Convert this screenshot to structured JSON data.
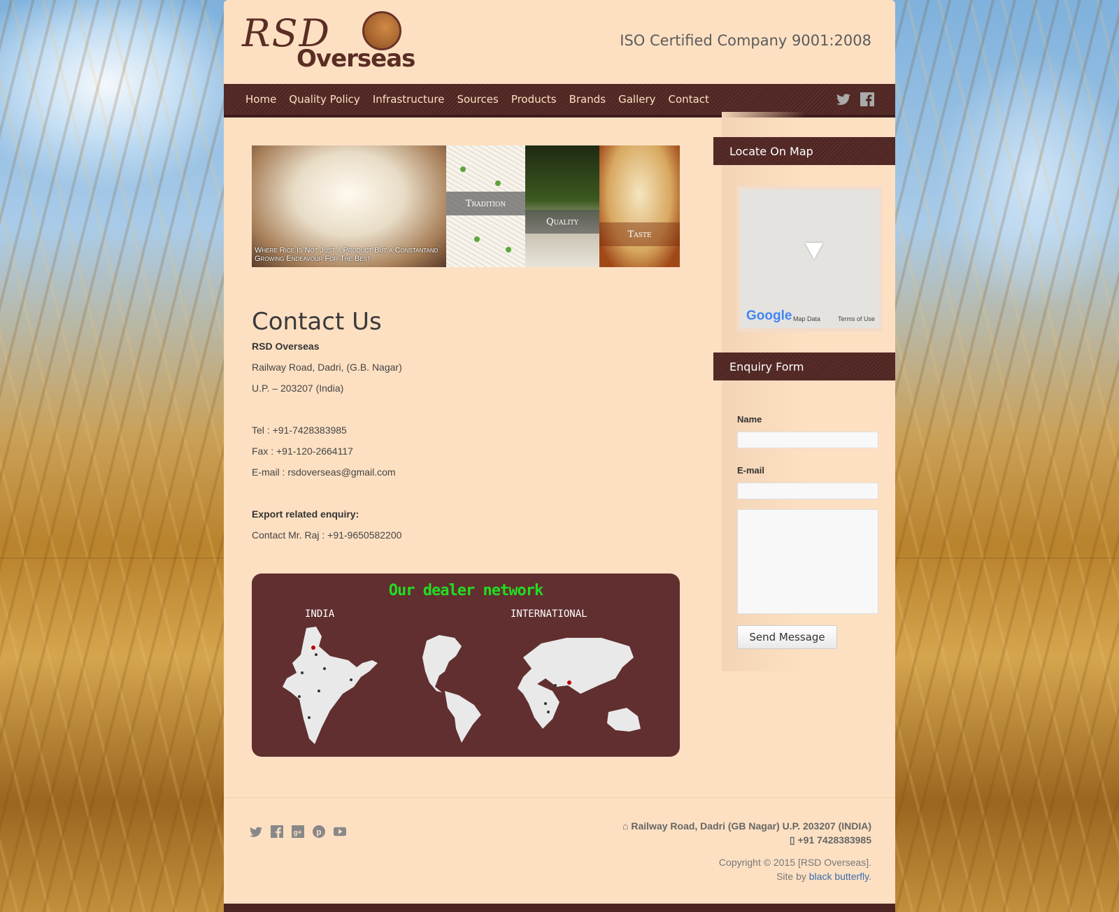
{
  "header": {
    "logo_line1": "RSD",
    "logo_line2": "Overseas",
    "iso": "ISO Certified Company 9001:2008"
  },
  "nav": {
    "items": [
      "Home",
      "Quality Policy",
      "Infrastructure",
      "Sources",
      "Products",
      "Brands",
      "Gallery",
      "Contact"
    ],
    "social": [
      "twitter-icon",
      "facebook-icon"
    ]
  },
  "banner": {
    "caption_main": "Where Rice Is Not Just a Product But a Constantand Growing Endeavour For The Best",
    "tiles": [
      "Tradition",
      "Quality",
      "Taste"
    ]
  },
  "contact": {
    "title": "Contact Us",
    "company": "RSD Overseas",
    "address1": "Railway Road, Dadri, (G.B. Nagar)",
    "address2": "U.P. – 203207 (India)",
    "tel": "Tel : +91-7428383985",
    "fax": "Fax : +91-120-2664117",
    "email": "E-mail : rsdoverseas@gmail.com",
    "export_label": "Export related enquiry:",
    "export_contact": "Contact Mr. Raj : +91-9650582200"
  },
  "dealer": {
    "title": "Our dealer network",
    "india": "INDIA",
    "international": "INTERNATIONAL"
  },
  "sidebar": {
    "map_title": "Locate On Map",
    "map_google": "Google",
    "map_data": "Map Data",
    "map_terms": "Terms of Use",
    "form_title": "Enquiry Form",
    "name_label": "Name",
    "email_label": "E-mail",
    "send": "Send Message"
  },
  "footer": {
    "address": "Railway Road, Dadri (GB Nagar) U.P. 203207 (INDIA)",
    "phone": "+91 7428383985",
    "copyright": "Copyright © 2015 [RSD Overseas].",
    "site_by": "Site by",
    "designer": "black butterfly",
    "period": "."
  },
  "colors": {
    "page": "#fde0c2",
    "nav": "#4c2522",
    "dealer_bg": "#612f2f",
    "dealer_title": "#22dd22"
  }
}
